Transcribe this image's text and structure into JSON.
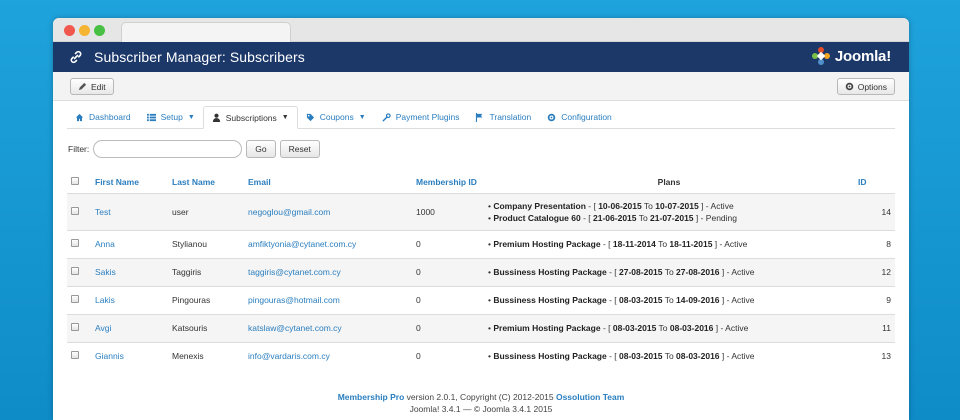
{
  "header": {
    "title": "Subscriber Manager: Subscribers",
    "logo_text": "Joomla!"
  },
  "toolbar": {
    "edit_label": "Edit",
    "options_label": "Options"
  },
  "nav": [
    {
      "label": "Dashboard",
      "icon": "home-icon"
    },
    {
      "label": "Setup",
      "icon": "list-icon",
      "dropdown": true
    },
    {
      "label": "Subscriptions",
      "icon": "user-icon",
      "dropdown": true,
      "active": true
    },
    {
      "label": "Coupons",
      "icon": "tag-icon",
      "dropdown": true
    },
    {
      "label": "Payment Plugins",
      "icon": "wrench-icon"
    },
    {
      "label": "Translation",
      "icon": "flag-icon"
    },
    {
      "label": "Configuration",
      "icon": "gear-icon"
    }
  ],
  "filter": {
    "label": "Filter:",
    "value": "",
    "go_label": "Go",
    "reset_label": "Reset"
  },
  "table": {
    "headers": {
      "first_name": "First Name",
      "last_name": "Last Name",
      "email": "Email",
      "membership_id": "Membership ID",
      "plans": "Plans",
      "id": "ID"
    },
    "rows": [
      {
        "first": "Test",
        "last": "user",
        "email": "negoglou@gmail.com",
        "membership_id": "1000",
        "id": "14",
        "plans": [
          {
            "name": "Company Presentation",
            "dash": " - [ ",
            "from": "10-06-2015",
            "to_word": " To ",
            "to": "10-07-2015",
            "status": " ] - Active"
          },
          {
            "name": "Product Catalogue 60",
            "dash": " - [ ",
            "from": "21-06-2015",
            "to_word": " To ",
            "to": "21-07-2015",
            "status": " ] - Pending"
          }
        ]
      },
      {
        "first": "Anna",
        "last": "Stylianou",
        "email": "amfiktyonia@cytanet.com.cy",
        "membership_id": "0",
        "id": "8",
        "plans": [
          {
            "name": "Premium Hosting Package",
            "dash": " - [ ",
            "from": "18-11-2014",
            "to_word": " To ",
            "to": "18-11-2015",
            "status": " ] - Active"
          }
        ]
      },
      {
        "first": "Sakis",
        "last": "Taggiris",
        "email": "taggiris@cytanet.com.cy",
        "membership_id": "0",
        "id": "12",
        "plans": [
          {
            "name": "Bussiness Hosting Package",
            "dash": " - [ ",
            "from": "27-08-2015",
            "to_word": " To ",
            "to": "27-08-2016",
            "status": " ] - Active"
          }
        ]
      },
      {
        "first": "Lakis",
        "last": "Pingouras",
        "email": "pingouras@hotmail.com",
        "membership_id": "0",
        "id": "9",
        "plans": [
          {
            "name": "Bussiness Hosting Package",
            "dash": " - [ ",
            "from": "08-03-2015",
            "to_word": " To ",
            "to": "14-09-2016",
            "status": " ] - Active"
          }
        ]
      },
      {
        "first": "Avgi",
        "last": "Katsouris",
        "email": "katslaw@cytanet.com.cy",
        "membership_id": "0",
        "id": "11",
        "plans": [
          {
            "name": "Premium Hosting Package",
            "dash": " - [ ",
            "from": "08-03-2015",
            "to_word": " To ",
            "to": "08-03-2016",
            "status": " ] - Active"
          }
        ]
      },
      {
        "first": "Giannis",
        "last": "Menexis",
        "email": "info@vardaris.com.cy",
        "membership_id": "0",
        "id": "13",
        "plans": [
          {
            "name": "Bussiness Hosting Package",
            "dash": " - [ ",
            "from": "08-03-2015",
            "to_word": " To ",
            "to": "08-03-2016",
            "status": " ] - Active"
          }
        ]
      }
    ]
  },
  "footer": {
    "product": "Membership Pro",
    "version_text": " version 2.0.1, Copyright (C) 2012-2015 ",
    "company": "Ossolution Team",
    "line2": "Joomla! 3.4.1  —  © Joomla 3.4.1 2015"
  },
  "colors": {
    "header_bg": "#1b3869",
    "link": "#2a7ebf",
    "background": "#1fa3dc"
  }
}
